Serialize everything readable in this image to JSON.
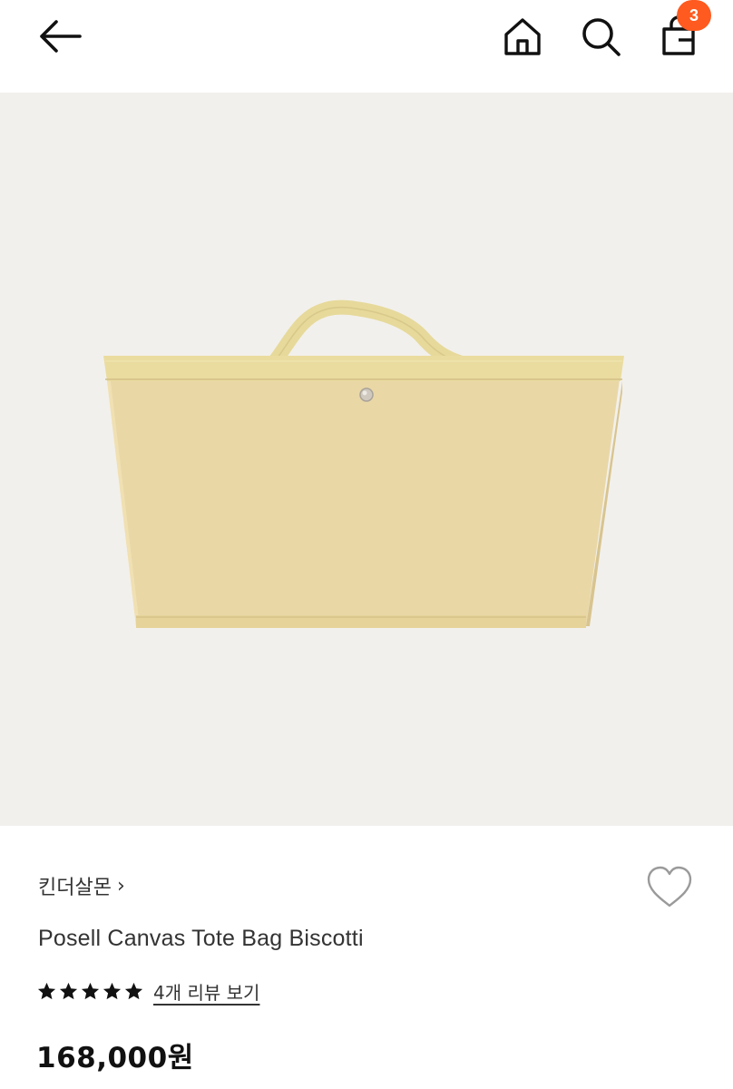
{
  "header": {
    "back_icon": "arrow-left-icon",
    "home_icon": "home-icon",
    "search_icon": "search-icon",
    "bag_icon": "shopping-bag-icon",
    "cart_count": "3",
    "badge_color": "#ff5a1f"
  },
  "product": {
    "image_background": "#f2f0ec",
    "image_subject": "canvas tote bag",
    "brand": "킨더살몬",
    "brand_chevron": "›",
    "title": "Posell Canvas Tote Bag Biscotti",
    "rating": 5,
    "rating_max": 5,
    "review_link": "4개 리뷰 보기",
    "price": "168,000원",
    "wishlist_icon": "heart-outline-icon"
  }
}
